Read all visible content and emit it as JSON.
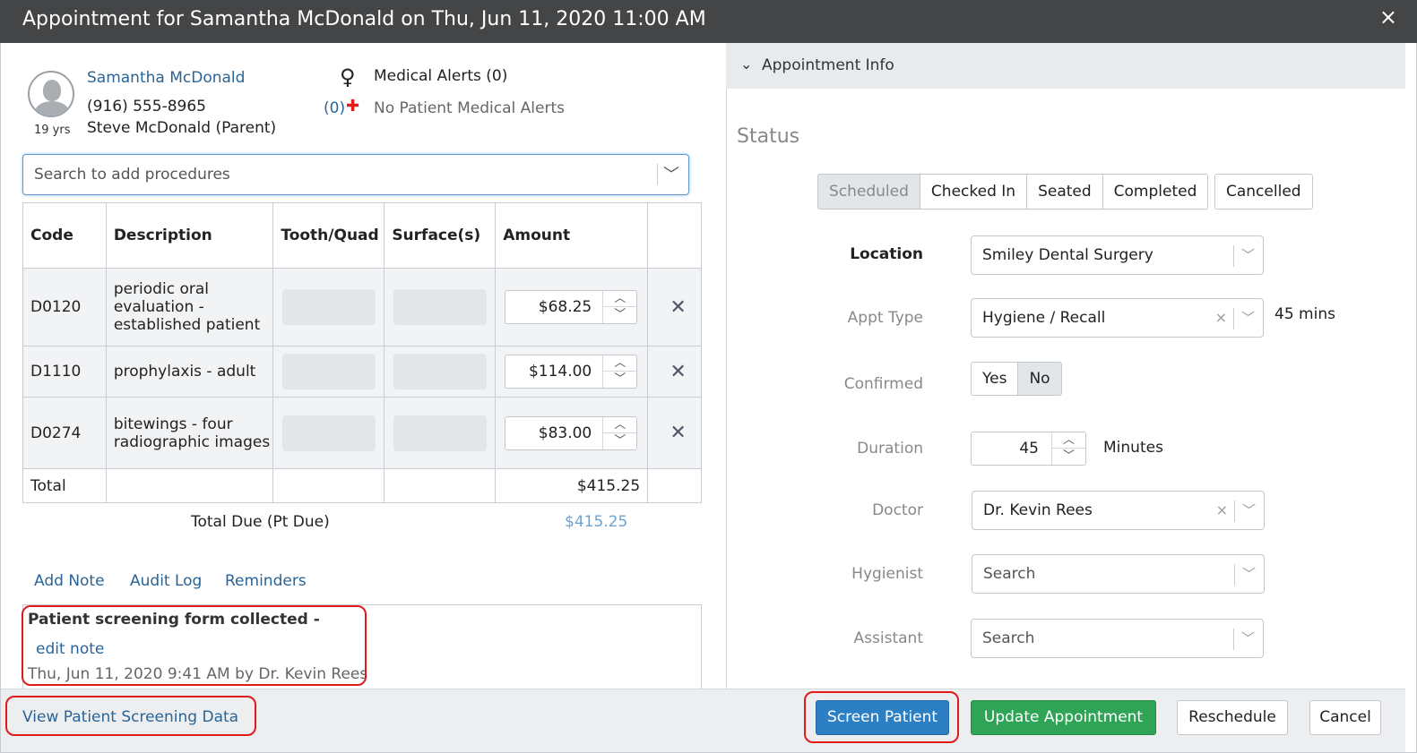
{
  "window": {
    "title": "Appointment for Samantha McDonald on Thu, Jun 11, 2020 11:00 AM",
    "close_icon": "×"
  },
  "patient": {
    "name": "Samantha McDonald",
    "phone": "(916) 555-8965",
    "guardian": "Steve McDonald (Parent)",
    "age": "19 yrs",
    "gender_icon": "female-icon"
  },
  "alerts": {
    "title": "Medical Alerts (0)",
    "count": "(0)",
    "none_text": "No Patient Medical Alerts"
  },
  "procedure_search": {
    "placeholder": "Search to add procedures"
  },
  "procedures": {
    "headers": [
      "Code",
      "Description",
      "Tooth/Quad",
      "Surface(s)",
      "Amount"
    ],
    "rows": [
      {
        "code": "D0120",
        "description": "periodic oral evaluation - established patient",
        "amount": "$68.25"
      },
      {
        "code": "D1110",
        "description": "prophylaxis - adult",
        "amount": "$114.00"
      },
      {
        "code": "D0274",
        "description": "bitewings - four radiographic images",
        "amount": "$83.00"
      }
    ],
    "total_label": "Total",
    "total_value": "$415.25",
    "total_due_label": "Total Due (Pt Due)",
    "total_due_value": "$415.25"
  },
  "links": {
    "add_note": "Add Note",
    "audit_log": "Audit Log",
    "reminders": "Reminders"
  },
  "note": {
    "title": "Patient screening form collected -",
    "edit_link": "edit note",
    "meta": "Thu, Jun 11, 2020 9:41 AM by Dr. Kevin Rees"
  },
  "appointment_info": {
    "section_label": "Appointment Info",
    "status_heading": "Status",
    "status_options": [
      "Scheduled",
      "Checked In",
      "Seated",
      "Completed"
    ],
    "status_active": "Scheduled",
    "cancelled_label": "Cancelled",
    "location_label": "Location",
    "location_value": "Smiley Dental Surgery",
    "appt_type_label": "Appt Type",
    "appt_type_value": "Hygiene / Recall",
    "appt_type_duration": "45 mins",
    "confirmed_label": "Confirmed",
    "confirmed_yes": "Yes",
    "confirmed_no": "No",
    "confirmed_value": "No",
    "duration_label": "Duration",
    "duration_value": "45",
    "duration_unit": "Minutes",
    "doctor_label": "Doctor",
    "doctor_value": "Dr. Kevin Rees",
    "hygienist_label": "Hygienist",
    "hygienist_placeholder": "Search",
    "assistant_label": "Assistant",
    "assistant_placeholder": "Search"
  },
  "footer": {
    "view_screening": "View Patient Screening Data",
    "screen_patient": "Screen Patient",
    "update_appointment": "Update Appointment",
    "reschedule": "Reschedule",
    "cancel": "Cancel"
  },
  "colors": {
    "title_bar": "#444546",
    "link": "#2a6496",
    "primary_button": "#2d7fc3",
    "success_button": "#2fa456",
    "highlight": "#e01b1b",
    "alert_cross": "#e02020"
  }
}
